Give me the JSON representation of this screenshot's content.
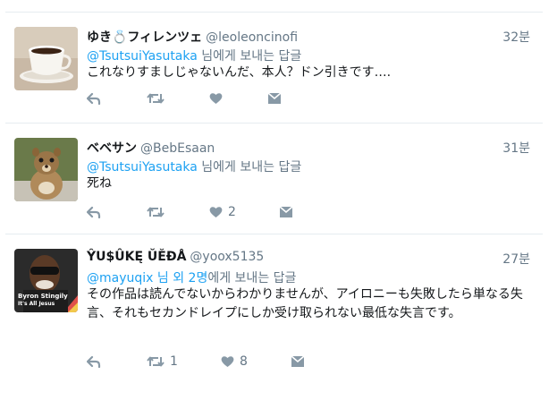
{
  "tweets": [
    {
      "name": "ゆき💍フィレンツェ",
      "handle": "@leoleoncinofi",
      "time": "32분",
      "reply_mentions": "@TsutsuiYasutaka",
      "reply_suffix": " 님에게 보내는 답글",
      "text": "これなりすましじゃないんだ、本人？ドン引きです….",
      "reply_count": "",
      "retweet_count": "",
      "like_count": ""
    },
    {
      "name": "ベベサン",
      "handle": "@BebEsaan",
      "time": "31분",
      "reply_mentions": "@TsutsuiYasutaka",
      "reply_suffix": " 님에게 보내는 답글",
      "text": "死ね",
      "reply_count": "",
      "retweet_count": "",
      "like_count": "2"
    },
    {
      "name": "ŶU$ÛKĘ ŬĔĐÅ",
      "handle": "@yoox5135",
      "time": "27분",
      "reply_mentions": "@mayuqix 님 외 2명",
      "reply_suffix": "에게 보내는 답글",
      "text": "その作品は読んでないからわかりませんが、アイロニーも失敗したら単なる失言、それもセカンドレイプにしか受け取られない最低な失言です。",
      "reply_count": "",
      "retweet_count": "1",
      "like_count": "8",
      "avatar_text": "Byron Stingily It's All Jesus"
    }
  ],
  "colors": {
    "link": "#1da1f2",
    "muted": "#657786",
    "icon": "#8899a6",
    "divider": "#e6ecf0"
  }
}
